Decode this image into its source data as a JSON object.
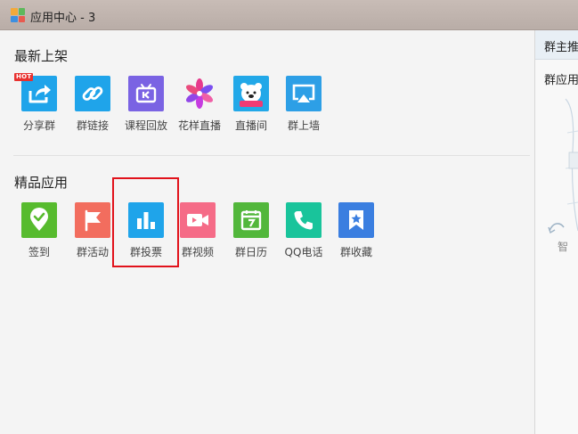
{
  "window": {
    "title": "应用中心 - 3"
  },
  "sections": {
    "latest": {
      "title": "最新上架"
    },
    "featured": {
      "title": "精品应用"
    }
  },
  "latest_apps": [
    {
      "label": "分享群",
      "icon": "share-icon",
      "color": "#1fa4ea",
      "badge": "HOT"
    },
    {
      "label": "群链接",
      "icon": "link-icon",
      "color": "#1fa4ea"
    },
    {
      "label": "课程回放",
      "icon": "tv-replay-icon",
      "color": "#7a63e3"
    },
    {
      "label": "花样直播",
      "icon": "flower-icon",
      "color": "#ffffff"
    },
    {
      "label": "直播间",
      "icon": "bear-icon",
      "color": "#22a8e8"
    },
    {
      "label": "群上墙",
      "icon": "airplay-icon",
      "color": "#2d9fe6"
    }
  ],
  "featured_apps": [
    {
      "label": "签到",
      "icon": "location-check-icon",
      "color": "#57bb2e"
    },
    {
      "label": "群活动",
      "icon": "flag-icon",
      "color": "#f26d5e"
    },
    {
      "label": "群投票",
      "icon": "bar-chart-icon",
      "color": "#1fa4ea"
    },
    {
      "label": "群视频",
      "icon": "video-camera-icon",
      "color": "#f56b87"
    },
    {
      "label": "群日历",
      "icon": "calendar-icon",
      "color": "#52b73b"
    },
    {
      "label": "QQ电话",
      "icon": "phone-icon",
      "color": "#19c49b"
    },
    {
      "label": "群收藏",
      "icon": "star-bookmark-icon",
      "color": "#3a7ee0"
    }
  ],
  "right_panel": {
    "tab_label": "群主推",
    "subtitle": "群应用",
    "caption": "智"
  }
}
